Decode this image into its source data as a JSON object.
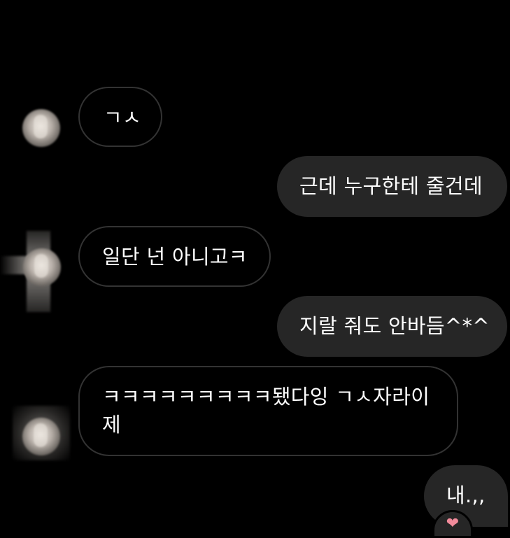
{
  "messages": [
    {
      "direction": "in",
      "text": "ㄱㅅ"
    },
    {
      "direction": "out",
      "text": "근데 누구한테 줄건데"
    },
    {
      "direction": "in",
      "text": "일단 넌 아니고ㅋ"
    },
    {
      "direction": "out",
      "text": "지랄 줘도 안바듬^*^"
    },
    {
      "direction": "in",
      "text": "ㅋㅋㅋㅋㅋㅋㅋㅋㅋ됐다잉 ㄱㅅ자라이\n제"
    },
    {
      "direction": "out",
      "text": "내.,,"
    }
  ],
  "reaction": {
    "icon": "heart-icon",
    "glyph": "❤"
  },
  "colors": {
    "background": "#000000",
    "incoming_border": "#333333",
    "outgoing_bubble": "#262626",
    "text": "#ffffff"
  }
}
